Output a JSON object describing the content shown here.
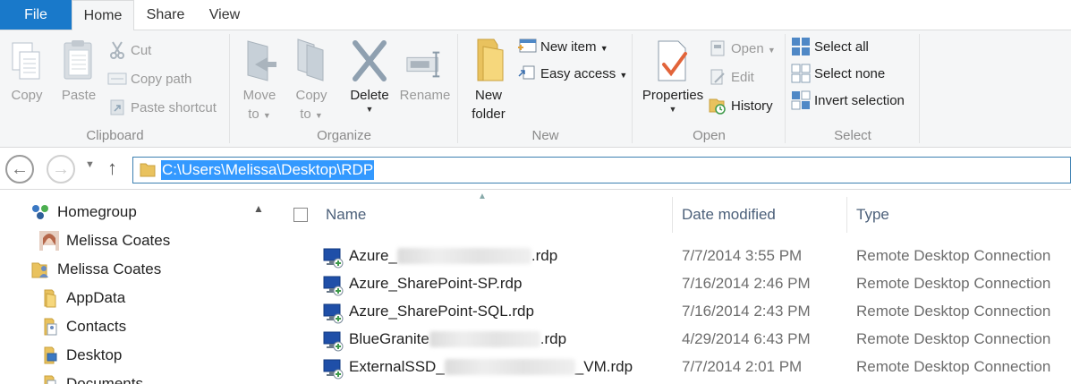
{
  "tabs": {
    "file": "File",
    "home": "Home",
    "share": "Share",
    "view": "View"
  },
  "ribbon": {
    "clipboard": {
      "label": "Clipboard",
      "copy": "Copy",
      "paste": "Paste",
      "cut": "Cut",
      "copy_path": "Copy path",
      "paste_shortcut": "Paste shortcut"
    },
    "organize": {
      "label": "Organize",
      "move_to_1": "Move",
      "move_to_2": "to",
      "copy_to_1": "Copy",
      "copy_to_2": "to",
      "delete": "Delete",
      "rename": "Rename"
    },
    "new": {
      "label": "New",
      "new_folder_1": "New",
      "new_folder_2": "folder",
      "new_item": "New item",
      "easy_access": "Easy access"
    },
    "open": {
      "label": "Open",
      "properties": "Properties",
      "open": "Open",
      "edit": "Edit",
      "history": "History"
    },
    "select": {
      "label": "Select",
      "select_all": "Select all",
      "select_none": "Select none",
      "invert_selection": "Invert selection"
    }
  },
  "address": {
    "path": "C:\\Users\\Melissa\\Desktop\\RDP"
  },
  "navpane": {
    "items": [
      {
        "label": "Homegroup",
        "icon": "homegroup-icon"
      },
      {
        "label": "Melissa Coates",
        "icon": "user-avatar-icon"
      },
      {
        "label": "Melissa Coates",
        "icon": "user-folder-icon"
      },
      {
        "label": "AppData",
        "icon": "folder-icon"
      },
      {
        "label": "Contacts",
        "icon": "contacts-folder-icon"
      },
      {
        "label": "Desktop",
        "icon": "desktop-folder-icon"
      },
      {
        "label": "Documents",
        "icon": "documents-folder-icon"
      }
    ]
  },
  "filelist": {
    "columns": {
      "name": "Name",
      "date": "Date modified",
      "type": "Type"
    },
    "rows": [
      {
        "name_prefix": "Azure_",
        "name_suffix": ".rdp",
        "date": "7/7/2014 3:55 PM",
        "type": "Remote Desktop Connection"
      },
      {
        "name_prefix": "Azure_SharePoint-SP.rdp",
        "name_suffix": "",
        "date": "7/16/2014 2:46 PM",
        "type": "Remote Desktop Connection"
      },
      {
        "name_prefix": "Azure_SharePoint-SQL.rdp",
        "name_suffix": "",
        "date": "7/16/2014 2:43 PM",
        "type": "Remote Desktop Connection"
      },
      {
        "name_prefix": "BlueGranite",
        "name_suffix": ".rdp",
        "date": "4/29/2014 6:43 PM",
        "type": "Remote Desktop Connection"
      },
      {
        "name_prefix": "ExternalSSD_",
        "name_suffix": "_VM.rdp",
        "date": "7/7/2014 2:01 PM",
        "type": "Remote Desktop Connection"
      }
    ]
  },
  "colors": {
    "accent": "#1979ca",
    "selection": "#3399ff",
    "ribbon_bg": "#f5f6f7"
  }
}
